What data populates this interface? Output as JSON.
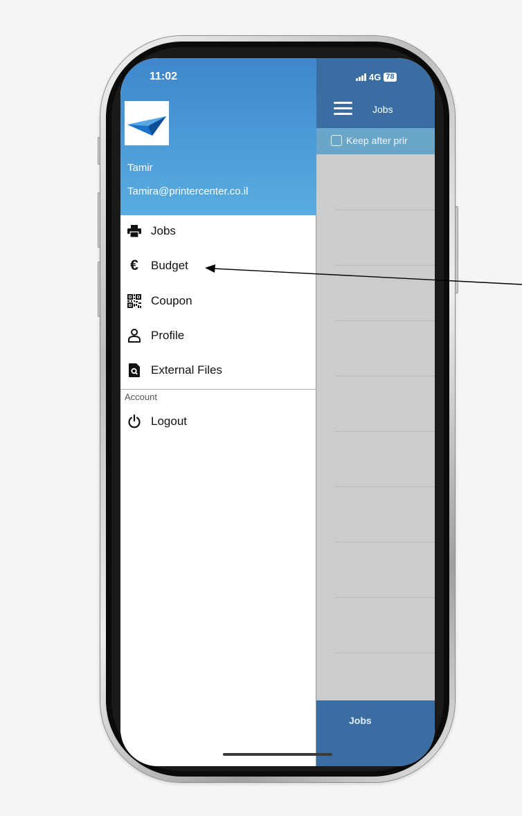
{
  "status_bar": {
    "time": "11:02",
    "network": "4G",
    "battery": "78",
    "signal_icon": "signal-bars-icon"
  },
  "background_app": {
    "title": "Jobs",
    "keep_after_print_label": "Keep after prir",
    "footer_tab_label": "Jobs",
    "header_color": "#3a6ea3",
    "toolbar_color": "#6aa6c9"
  },
  "drawer": {
    "header_gradient": [
      "#3f86cc",
      "#58ade0"
    ],
    "user_name": "Tamir",
    "user_email": "Tamira@printercenter.co.il",
    "items": [
      {
        "label": "Jobs",
        "icon": "printer-icon"
      },
      {
        "label": "Budget",
        "icon": "euro-icon"
      },
      {
        "label": "Coupon",
        "icon": "qr-code-icon"
      },
      {
        "label": "Profile",
        "icon": "person-icon"
      },
      {
        "label": "External Files",
        "icon": "file-search-icon"
      }
    ],
    "account_section_label": "Account",
    "account_items": [
      {
        "label": "Logout",
        "icon": "power-icon"
      }
    ]
  }
}
